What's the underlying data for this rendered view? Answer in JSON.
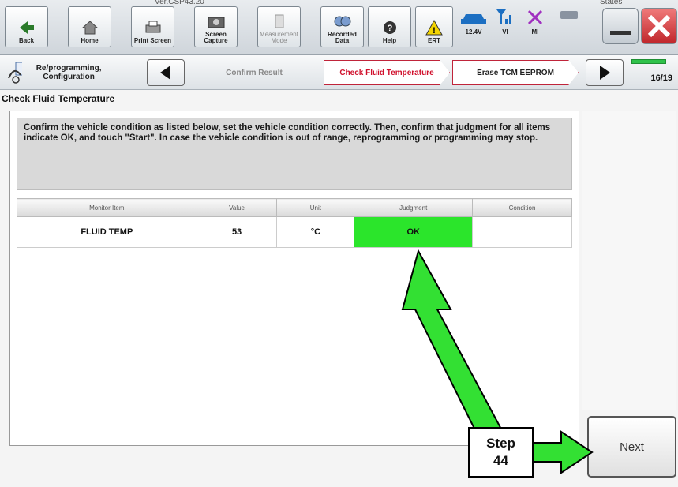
{
  "app": {
    "version": "Ver.CSP43.20",
    "states_label": "States"
  },
  "toolbar": {
    "back": "Back",
    "home": "Home",
    "print_screen": "Print Screen",
    "screen_capture": "Screen Capture",
    "measurement_mode": "Measurement Mode",
    "recorded_data": "Recorded Data",
    "help": "Help",
    "ert": "ERT",
    "battery": "12.4V",
    "vi": "VI",
    "mi": "MI"
  },
  "nav": {
    "section": "Re/programming, Configuration",
    "prev_step": "Confirm Result",
    "current_step": "Check Fluid Temperature",
    "next_step": "Erase TCM EEPROM",
    "progress_text": "16/19",
    "progress_fraction": 0.84
  },
  "page": {
    "title": "Check Fluid Temperature",
    "instruction": "Confirm the vehicle condition as listed below, set the vehicle condition correctly. Then, confirm that judgment for all items indicate OK, and touch \"Start\". In case the vehicle condition is out of range, reprogramming or programming may stop."
  },
  "table": {
    "headers": [
      "Monitor Item",
      "Value",
      "Unit",
      "Judgment",
      "Condition"
    ],
    "rows": [
      {
        "item": "FLUID TEMP",
        "value": "53",
        "unit": "°C",
        "judgment": "OK",
        "condition": ""
      }
    ]
  },
  "buttons": {
    "next": "Next"
  },
  "annotation": {
    "step_line1": "Step",
    "step_line2": "44"
  },
  "colors": {
    "ok_green": "#2be52b",
    "arrow_green": "#33e033",
    "accent_red": "#d0102c"
  }
}
